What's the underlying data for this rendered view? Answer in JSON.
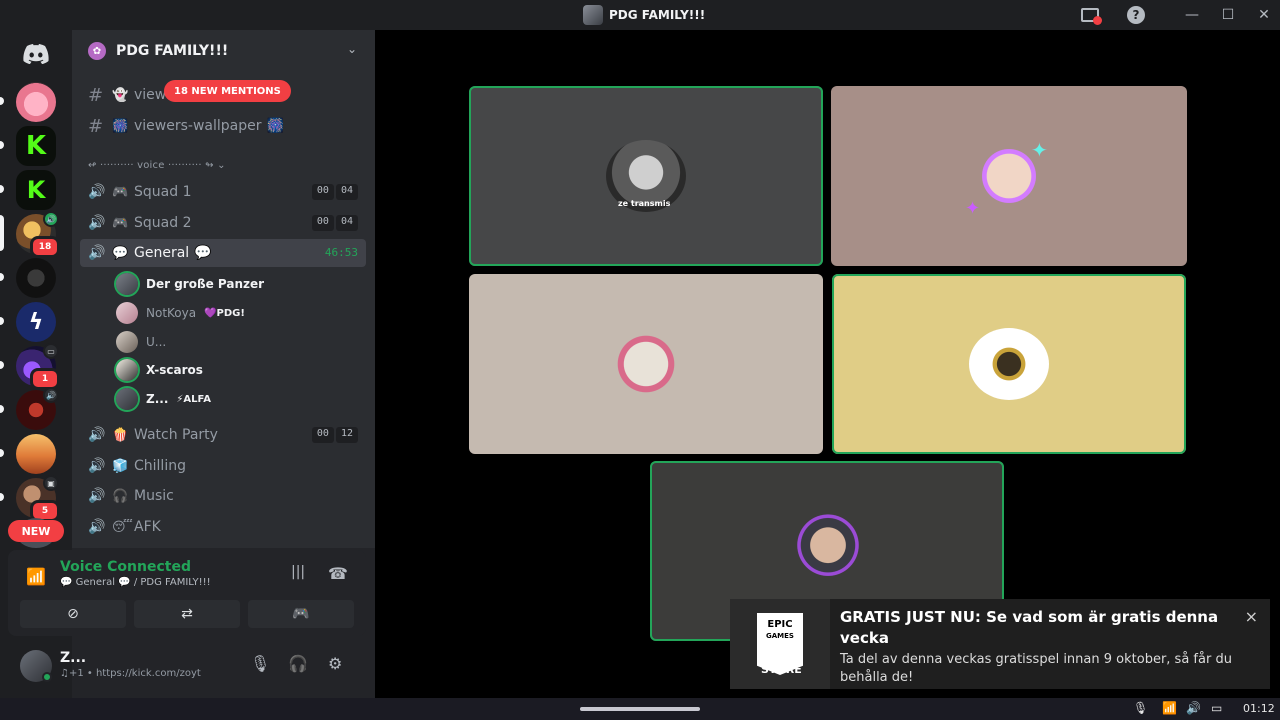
{
  "window": {
    "title": "PDG FAMILY!!!"
  },
  "rail": {
    "new_label": "NEW",
    "badges": [
      "18",
      "1",
      "5"
    ]
  },
  "server": {
    "name": "PDG FAMILY!!!",
    "mention_banner": "18 NEW MENTIONS",
    "text_channels": [
      {
        "name": "view",
        "emoji": "👻"
      },
      {
        "name": "viewers-wallpaper",
        "emoji": "🎆",
        "emoji_after": "🎆"
      }
    ],
    "category": "↫ ·········· voice ·········· ↬ ⌄",
    "voice_channels": [
      {
        "name": "Squad 1",
        "emoji": "🎮",
        "timer": [
          "00",
          "04"
        ]
      },
      {
        "name": "Squad 2",
        "emoji": "🎮",
        "timer": [
          "00",
          "04"
        ]
      },
      {
        "name": "General",
        "emoji": "💬",
        "emoji_after": "💬",
        "elapsed": "46:53",
        "active": true
      },
      {
        "name": "Watch Party",
        "emoji": "🍿",
        "timer": [
          "00",
          "12"
        ]
      },
      {
        "name": "Chilling",
        "emoji": "🧊"
      },
      {
        "name": "Music",
        "emoji": "🎧"
      },
      {
        "name": "AFK",
        "emoji": "😴"
      }
    ],
    "voice_users": [
      {
        "name": "Der große Panzer",
        "tag": ""
      },
      {
        "name": "NotKoya",
        "tag": "💜PDG!"
      },
      {
        "name": "U...",
        "tag": ""
      },
      {
        "name": "X-scaros",
        "tag": ""
      },
      {
        "name": "Z...",
        "tag": "⚡ALFA"
      }
    ]
  },
  "voice_panel": {
    "title": "Voice Connected",
    "subtitle": "💬 General 💬 / PDG FAMILY!!!"
  },
  "user_panel": {
    "name": "Z...",
    "status": "♫+1 • https://kick.com/zoyt"
  },
  "stage": {
    "tile_label": "ze transmis"
  },
  "toast": {
    "logo_top": "EPIC",
    "logo_mid": "GAMES",
    "logo_bottom": "STORE",
    "title": "GRATIS JUST NU: Se vad som är gratis denna vecka",
    "body": "Ta del av denna veckas gratisspel innan 9 oktober, så får du behålla de!",
    "close": "×"
  },
  "taskbar": {
    "time": "01:12"
  },
  "colors": {
    "green": "#23a559",
    "red": "#f23f43",
    "sidebar_bg": "#2b2d31",
    "rail_bg": "#1e1f22"
  }
}
